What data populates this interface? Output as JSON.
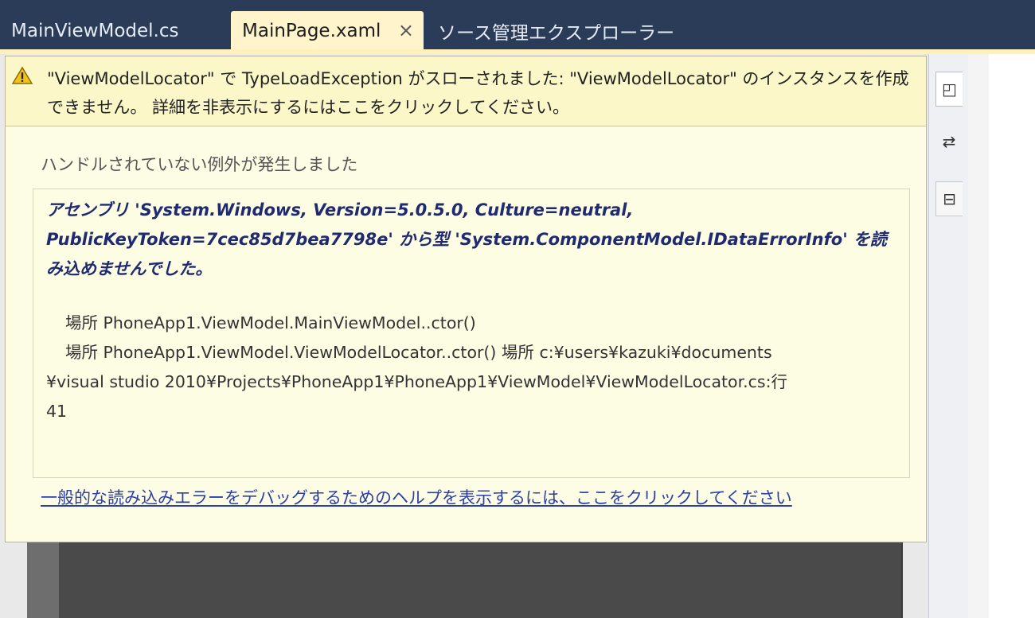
{
  "tabs": [
    {
      "label": "MainViewModel.cs",
      "active": false
    },
    {
      "label": "MainPage.xaml",
      "active": true,
      "close_glyph": "×"
    },
    {
      "label": "ソース管理エクスプローラー",
      "active": false
    }
  ],
  "warning": {
    "icon": "warning-triangle-icon",
    "message": "\"ViewModelLocator\" で TypeLoadException がスローされました: \"ViewModelLocator\" のインスタンスを作成できません。 詳細を非表示にするにはここをクリックしてください。"
  },
  "exception": {
    "heading": "ハンドルされていない例外が発生しました",
    "summary": "アセンブリ 'System.Windows, Version=5.0.5.0, Culture=neutral, PublicKeyToken=7cec85d7bea7798e' から型 'System.ComponentModel.IDataErrorInfo' を読み込めませんでした。",
    "stack": [
      "場所 PhoneApp1.ViewModel.MainViewModel..ctor()",
      "場所 PhoneApp1.ViewModel.ViewModelLocator..ctor() 場所 c:¥users¥kazuki¥documents",
      "¥visual studio 2010¥Projects¥PhoneApp1¥PhoneApp1¥ViewModel¥ViewModelLocator.cs:行",
      "41"
    ]
  },
  "help_link": "一般的な読み込みエラーをデバッグするためのヘルプを表示するには、ここをクリックしてください",
  "side_tabs": [
    {
      "icon": "design-view-icon",
      "glyph": "◰"
    },
    {
      "icon": "swap-panes-icon",
      "glyph": "⇄"
    },
    {
      "icon": "split-view-icon",
      "glyph": "⊟"
    }
  ],
  "colors": {
    "chrome": "#2b3c59",
    "active_tab": "#fff4cc",
    "warning_bar": "#fbf7c9",
    "popup": "#fdfde6",
    "bold_text": "#1f2a70",
    "link": "#2b3fa8"
  }
}
